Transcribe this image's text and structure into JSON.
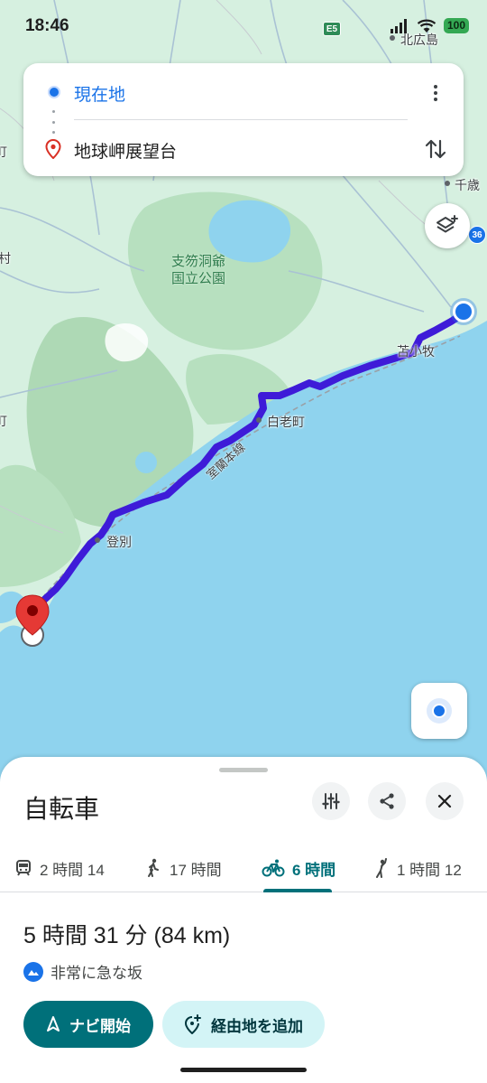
{
  "status": {
    "time": "18:46",
    "battery": "100",
    "highway_badge": "E5"
  },
  "route_card": {
    "origin": "現在地",
    "destination": "地球岬展望台"
  },
  "map": {
    "labels": {
      "kitahiroshima": "北広島",
      "chitose": "千歳",
      "park": [
        "支笏洞爺",
        "国立公園"
      ],
      "tomakomai": "苫小牧",
      "shiraoi": "白老町",
      "railway": "室蘭本線",
      "noboribetsu": "登別",
      "edge_left_1": "町",
      "edge_left_2": "村",
      "edge_left_3": "町"
    },
    "route_number": "36",
    "colors": {
      "water": "#8fd3ee",
      "land": "#d6f0e0",
      "forest": "#aed9b5",
      "route": "#3e1bd8",
      "accent": "#1a73e8",
      "pin": "#e53935"
    }
  },
  "sheet": {
    "title": "自転車",
    "modes": [
      {
        "name": "transit",
        "label": "2 時間 14",
        "icon": "train-icon"
      },
      {
        "name": "walk",
        "label": "17 時間",
        "icon": "walk-icon"
      },
      {
        "name": "bike",
        "label": "6 時間",
        "icon": "bike-icon",
        "active": true
      },
      {
        "name": "ride",
        "label": "1 時間 12",
        "icon": "person-hail-icon"
      }
    ],
    "duration": "5 時間 31 分 (84 km)",
    "warning": "非常に急な坂",
    "start_label": "ナビ開始",
    "add_stop_label": "経由地を追加"
  }
}
